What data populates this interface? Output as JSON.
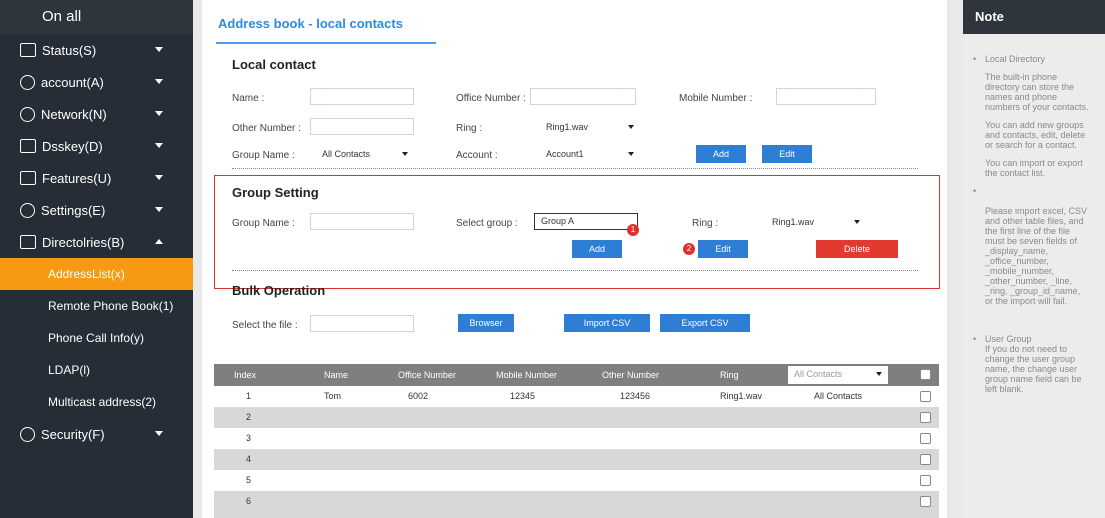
{
  "sidebar": {
    "title": "On all",
    "items": [
      {
        "label": "Status(S)"
      },
      {
        "label": "account(A)"
      },
      {
        "label": "Network(N)"
      },
      {
        "label": "Dsskey(D)"
      },
      {
        "label": "Features(U)"
      },
      {
        "label": "Settings(E)"
      },
      {
        "label": "Directolries(B)"
      }
    ],
    "sub_items": [
      {
        "label": "AddressList(x)",
        "active": true
      },
      {
        "label": "Remote Phone Book(1)"
      },
      {
        "label": "Phone Call Info(y)"
      },
      {
        "label": "LDAP(l)"
      },
      {
        "label": "Multicast address(2)"
      }
    ],
    "last_item": {
      "label": "Security(F)"
    }
  },
  "main": {
    "title": "Address book - local contacts",
    "local_contact": {
      "heading": "Local contact",
      "name_label": "Name :",
      "office_label": "Office Number :",
      "mobile_label": "Mobile Number :",
      "other_label": "Other Number :",
      "ring_label": "Ring :",
      "ring_value": "Ring1.wav",
      "group_label": "Group Name :",
      "group_value": "All Contacts",
      "account_label": "Account :",
      "account_value": "Account1",
      "add_label": "Add",
      "edit_label": "Edit"
    },
    "group_setting": {
      "heading": "Group Setting",
      "group_name_label": "Group Name :",
      "select_group_label": "Select group :",
      "select_group_value": "Group A",
      "ring_label": "Ring :",
      "ring_value": "Ring1.wav",
      "add_label": "Add",
      "edit_label": "Edit",
      "delete_label": "Delete",
      "badge1": "1",
      "badge2": "2"
    },
    "bulk": {
      "heading": "Bulk Operation",
      "file_label": "Select the file :",
      "browse_label": "Browser",
      "import_label": "Import CSV",
      "export_label": "Export CSV"
    },
    "table": {
      "headers": [
        "Index",
        "Name",
        "Office Number",
        "Mobile Number",
        "Other Number",
        "Ring"
      ],
      "filter_value": "All Contacts",
      "rows": [
        {
          "index": "1",
          "name": "Tom",
          "office": "6002",
          "mobile": "12345",
          "other": "123456",
          "ring": "Ring1.wav",
          "group": "All Contacts"
        },
        {
          "index": "2"
        },
        {
          "index": "3"
        },
        {
          "index": "4"
        },
        {
          "index": "5"
        },
        {
          "index": "6"
        }
      ]
    }
  },
  "note": {
    "title": "Note",
    "local_dir_heading": "Local Directory",
    "p1": "The built-in phone\ndirectory can store the\nnames and phone\nnumbers of your contacts.",
    "p2": "You can add new groups\nand contacts, edit, delete\nor search for a contact.",
    "p3": "You can import or export\nthe contact list.",
    "import_note": "Please import excel, CSV\nand other table files, and\nthe first line of the file\nmust be seven fields of\n_display_name,\n_office_number,\n_mobile_number,\n_other_number, _line,\n_ring, _group_id_name,\nor the import will fail.",
    "user_group_heading": "User Group",
    "user_group_text": "If you do not need to\nchange the user group\nname, the change user\ngroup name field can be\nleft blank."
  }
}
